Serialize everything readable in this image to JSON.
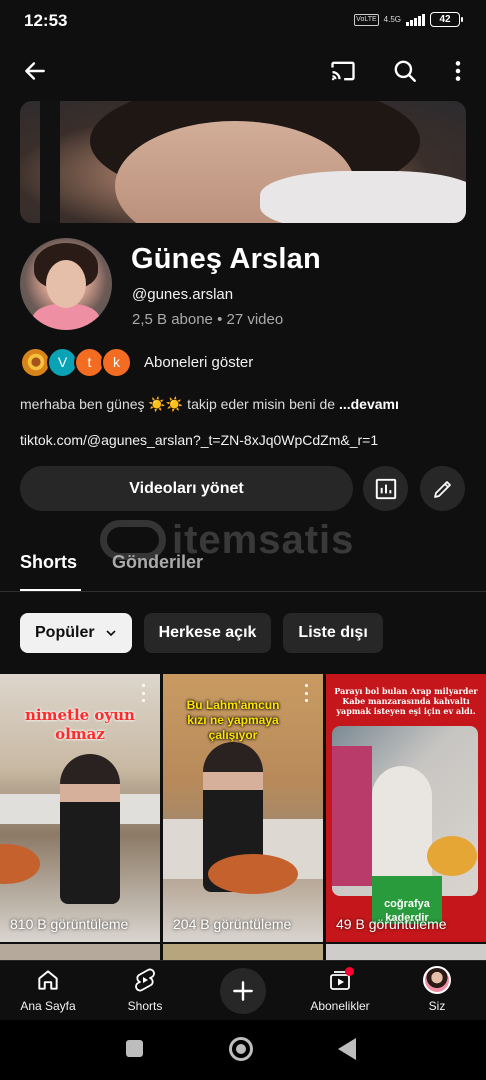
{
  "status_bar": {
    "time": "12:53",
    "network": "4.5G",
    "volte": "VoLTE",
    "battery": "42"
  },
  "channel": {
    "name": "Güneş Arslan",
    "handle": "@gunes.arslan",
    "stats": "2,5 B abone • 27 video",
    "subscribers_label": "Aboneleri göster",
    "subscriber_avatars": [
      "",
      "V",
      "t",
      "k"
    ],
    "description": "merhaba ben güneş ☀️☀️ takip eder misin beni de ",
    "description_more": "...devamı",
    "link": "tiktok.com/@agunes_arslan?_t=ZN-8xJq0WpCdZm&_r=1"
  },
  "actions": {
    "manage_label": "Videoları yönet",
    "stats_icon": "bar-chart-icon",
    "edit_icon": "pencil-icon"
  },
  "watermark": {
    "text": "itemsatis"
  },
  "tabs": [
    {
      "label": "Shorts",
      "active": true
    },
    {
      "label": "Gönderiler",
      "active": false
    }
  ],
  "chips": [
    {
      "label": "Popüler",
      "active": true
    },
    {
      "label": "Herkese açık",
      "active": false
    },
    {
      "label": "Liste dışı",
      "active": false
    }
  ],
  "shorts": [
    {
      "overlay": "nimetle oyun olmaz",
      "views": "810 B görüntüleme"
    },
    {
      "overlay": "Bu Lahm'amcun kızı ne yapmaya çalışıyor",
      "views": "204 B görüntüleme"
    },
    {
      "overlay": "Parayı bol bulan Arap milyarder Kabe manzarasında kahvaltı yapmak isteyen eşi için ev aldı.",
      "views": "49 B görüntüleme",
      "badge": "coğrafya kaderdir"
    }
  ],
  "bottom_nav": [
    {
      "label": "Ana Sayfa",
      "icon": "home-icon"
    },
    {
      "label": "Shorts",
      "icon": "shorts-icon"
    },
    {
      "label": "",
      "icon": "plus-icon"
    },
    {
      "label": "Abonelikler",
      "icon": "subscriptions-icon"
    },
    {
      "label": "Siz",
      "icon": "avatar"
    }
  ],
  "colors": {
    "background": "#0f0f0f",
    "surface": "#272727",
    "secondary_text": "#aaaaaa",
    "notification": "#ff0033"
  }
}
